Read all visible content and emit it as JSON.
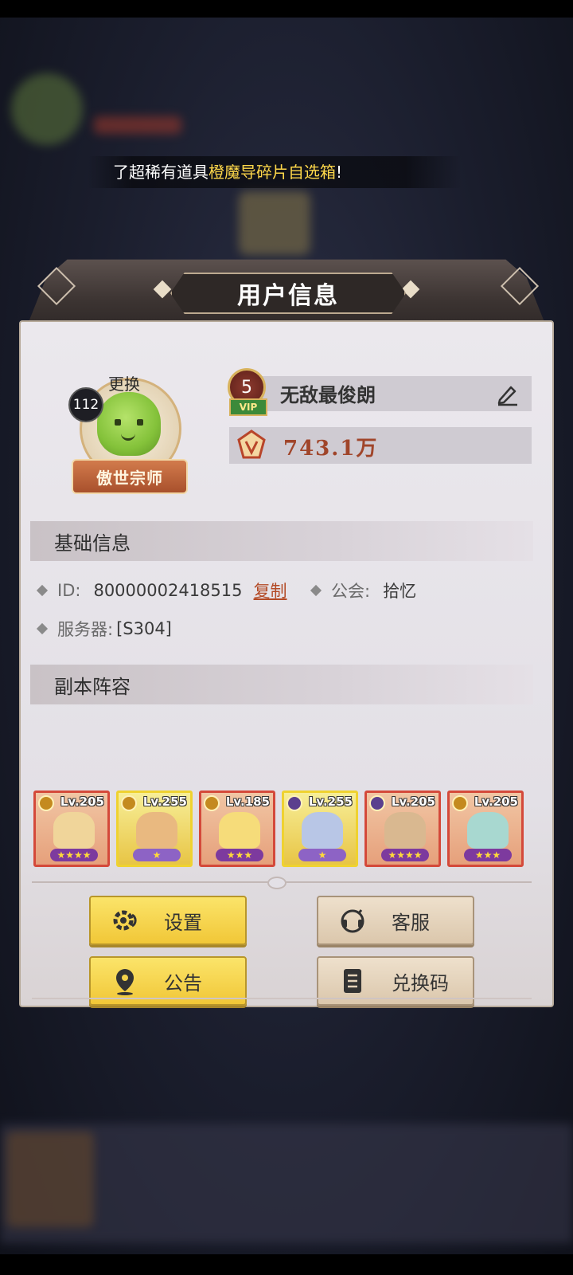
{
  "marquee": {
    "prefix": "了超稀有道具",
    "highlight": "橙魔导碎片自选箱",
    "suffix": "!"
  },
  "panel": {
    "title": "用户信息"
  },
  "profile": {
    "avatar_level": "112",
    "change_label": "更换",
    "title_badge": "傲世宗师",
    "vip_level": "5",
    "vip_tag": "VIP",
    "name": "无敌最俊朗",
    "power": "743.1万"
  },
  "basic_info": {
    "header": "基础信息",
    "id_label": "ID:",
    "id_value": "80000002418515",
    "copy_label": "复制",
    "guild_label": "公会:",
    "guild_value": "拾忆",
    "server_label": "服务器:",
    "server_value": "[S304]"
  },
  "lineup": {
    "header": "副本阵容",
    "heroes": [
      {
        "level": "Lv.205",
        "frame": "red",
        "stars": "★★★★"
      },
      {
        "level": "Lv.255",
        "frame": "gold",
        "stars": "★"
      },
      {
        "level": "Lv.185",
        "frame": "red",
        "stars": "★★★"
      },
      {
        "level": "Lv.255",
        "frame": "gold",
        "stars": "★"
      },
      {
        "level": "Lv.205",
        "frame": "red",
        "stars": "★★★★"
      },
      {
        "level": "Lv.205",
        "frame": "red",
        "stars": "★★★"
      }
    ]
  },
  "buttons": {
    "settings": "设置",
    "support": "客服",
    "notice": "公告",
    "redeem": "兑换码"
  },
  "colors": {
    "accent_yellow": "#f1c737",
    "highlight_text": "#ffd84a",
    "power_text": "#a0452a",
    "copy_link": "#b34a25"
  }
}
